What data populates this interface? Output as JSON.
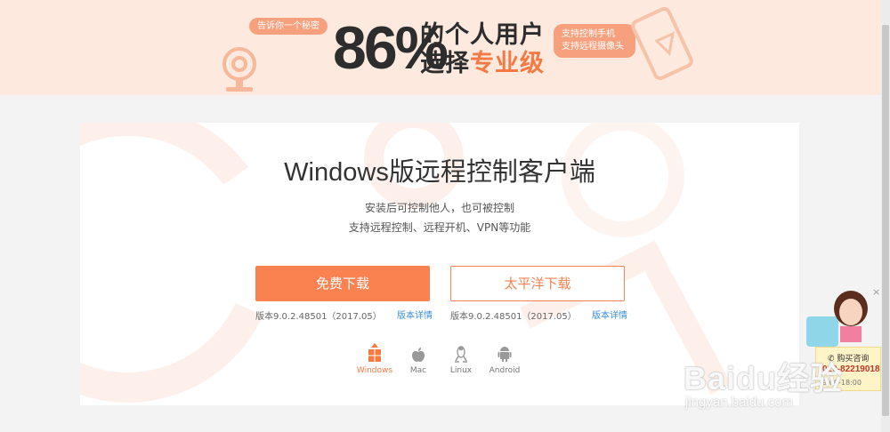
{
  "banner": {
    "bubble_left": "告诉你一个秘密",
    "big_number": "86%",
    "headline_line1": "的个人用户",
    "headline_line2_prefix": "选择",
    "headline_line2_highlight": "专业级",
    "bubble_right_line1": "支持控制手机",
    "bubble_right_line2": "支持远程摄像头"
  },
  "main": {
    "title": "Windows版远程控制客户端",
    "subtitle_line1": "安装后可控制他人，也可被控制",
    "subtitle_line2": "支持远程控制、远程开机、VPN等功能"
  },
  "downloads": [
    {
      "label": "免费下载",
      "version": "版本9.0.2.48501（2017.05）",
      "details": "版本详情"
    },
    {
      "label": "太平洋下载",
      "version": "版本9.0.2.48501（2017.05）",
      "details": "版本详情"
    }
  ],
  "platforms": [
    {
      "label": "Windows",
      "icon": "windows-icon",
      "active": true
    },
    {
      "label": "Mac",
      "icon": "apple-icon",
      "active": false
    },
    {
      "label": "Linux",
      "icon": "linux-icon",
      "active": false
    },
    {
      "label": "Android",
      "icon": "android-icon",
      "active": false
    }
  ],
  "service": {
    "close": "×",
    "label": "购买咨询",
    "phone": "020-82219018",
    "hours": "9:00-18:00"
  },
  "watermark": {
    "logo": "Baidu经验",
    "url": "jingyan.baidu.com"
  },
  "colors": {
    "accent": "#fa8250",
    "banner_bg": "#fde9dd",
    "link": "#3b8fd9"
  }
}
